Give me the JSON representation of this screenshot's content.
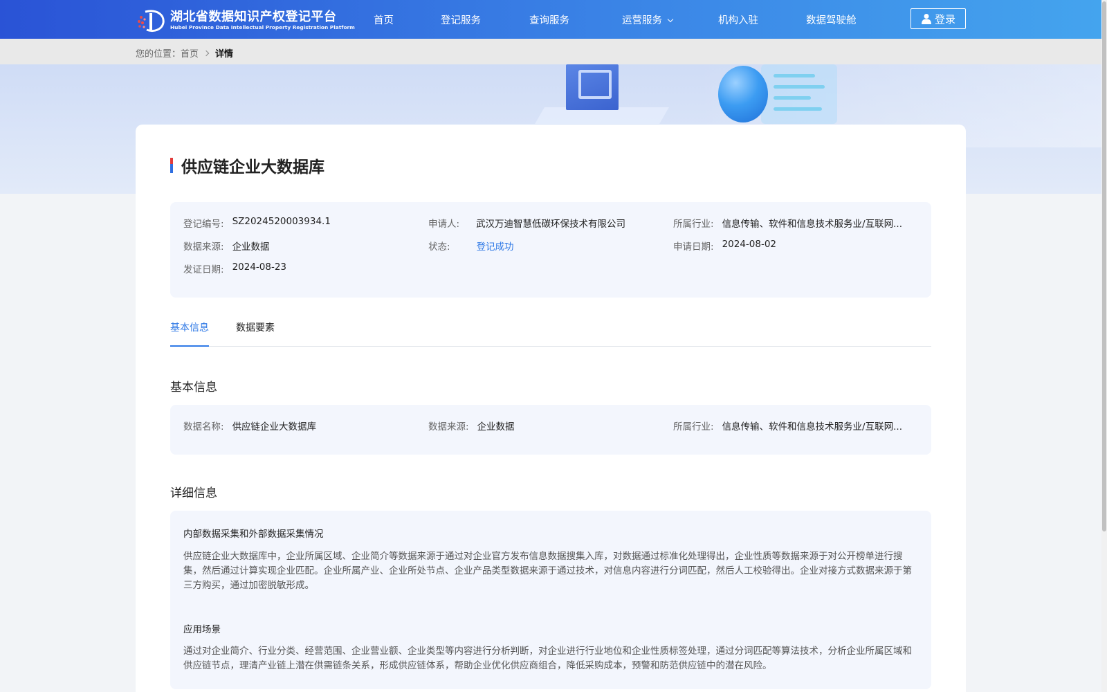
{
  "header": {
    "logo_cn": "湖北省数据知识产权登记平台",
    "logo_en": "Hubei Province Data Intellectual Property Registration Platform",
    "nav": [
      {
        "label": "首页"
      },
      {
        "label": "登记服务"
      },
      {
        "label": "查询服务"
      },
      {
        "label": "运营服务"
      },
      {
        "label": "机构入驻"
      },
      {
        "label": "数据驾驶舱"
      }
    ],
    "login_label": "登录"
  },
  "breadcrumb": {
    "prefix": "您的位置：",
    "home": "首页",
    "current": "详情"
  },
  "detail": {
    "title": "供应链企业大数据库",
    "summary": {
      "reg_no_label": "登记编号:",
      "reg_no": "SZ2024520003934.1",
      "applicant_label": "申请人:",
      "applicant": "武汉万迪智慧低碳环保技术有限公司",
      "industry_label": "所属行业:",
      "industry": "信息传输、软件和信息技术服务业/互联网...",
      "source_label": "数据来源:",
      "source": "企业数据",
      "status_label": "状态:",
      "status": "登记成功",
      "apply_date_label": "申请日期:",
      "apply_date": "2024-08-02",
      "issue_date_label": "发证日期:",
      "issue_date": "2024-08-23"
    },
    "tabs": [
      {
        "label": "基本信息"
      },
      {
        "label": "数据要素"
      }
    ],
    "basic": {
      "section_title": "基本信息",
      "name_label": "数据名称:",
      "name": "供应链企业大数据库",
      "source_label": "数据来源:",
      "source": "企业数据",
      "industry_label": "所属行业:",
      "industry": "信息传输、软件和信息技术服务业/互联网..."
    },
    "details": {
      "section_title": "详细信息",
      "collection_title": "内部数据采集和外部数据采集情况",
      "collection_text": "供应链企业大数据库中，企业所属区域、企业简介等数据来源于通过对企业官方发布信息数据搜集入库，对数据通过标准化处理得出，企业性质等数据来源于对公开榜单进行搜集，然后通过计算实现企业匹配。企业所属产业、企业所处节点、企业产品类型数据来源于通过技术，对信息内容进行分词匹配，然后人工校验得出。企业对接方式数据来源于第三方购买，通过加密脱敏形成。",
      "scenario_title": "应用场景",
      "scenario_text": "通过对企业简介、行业分类、经营范围、企业营业额、企业类型等内容进行分析判断，对企业进行行业地位和企业性质标签处理，通过分词匹配等算法技术，分析企业所属区域和供应链节点，理清产业链上潜在供需链条关系，形成供应链体系，帮助企业优化供应商组合，降低采购成本，预警和防范供应链中的潜在风险。"
    }
  }
}
